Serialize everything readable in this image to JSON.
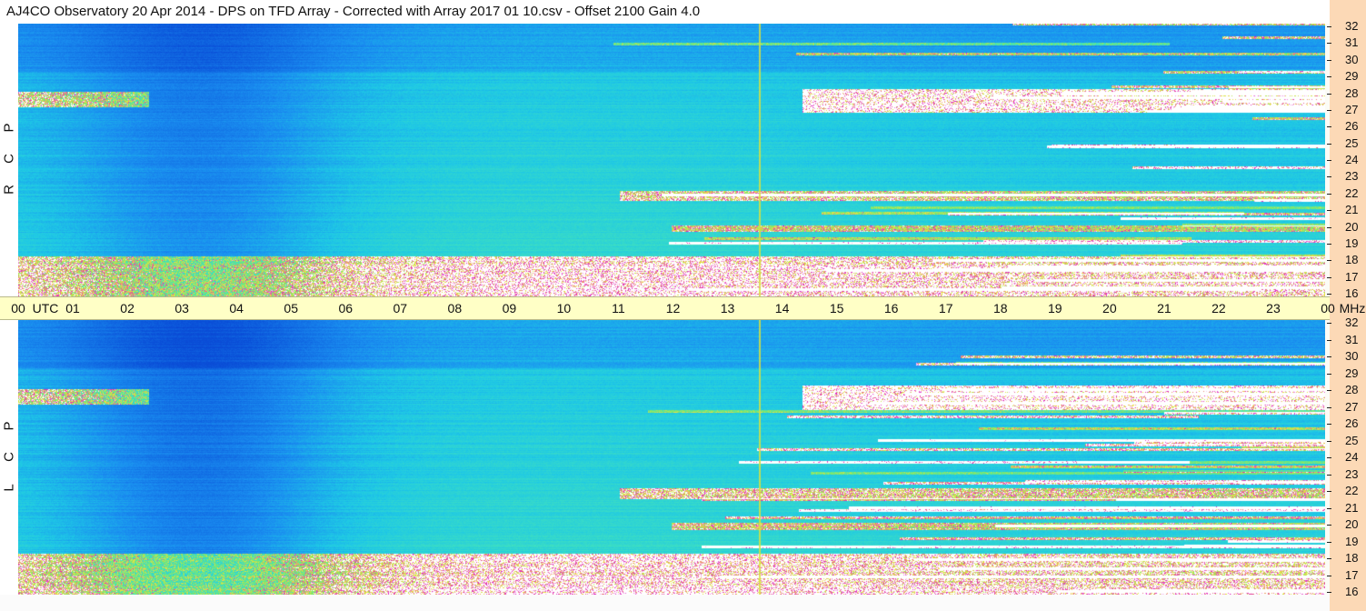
{
  "title": "AJ4CO Observatory  20 Apr 2014  -  DPS on TFD Array  -  Corrected with Array 2017 01 10.csv  -  Offset 2100  Gain 4.0",
  "chart_data": [
    {
      "type": "heatmap",
      "panel": "top",
      "polarization_label": [
        "R",
        "C",
        "P"
      ],
      "x_range_utc_hours": [
        0,
        24
      ],
      "y_range_mhz": [
        16,
        32
      ],
      "y_ticks": [
        "32",
        "31",
        "30",
        "29",
        "28",
        "27",
        "26",
        "25",
        "24",
        "23",
        "22",
        "21",
        "20",
        "19",
        "18",
        "17",
        "16"
      ]
    },
    {
      "type": "heatmap",
      "panel": "bottom",
      "polarization_label": [
        "L",
        "C",
        "P"
      ],
      "x_range_utc_hours": [
        0,
        24
      ],
      "y_range_mhz": [
        16,
        32
      ],
      "y_ticks": [
        "32",
        "31",
        "30",
        "29",
        "28",
        "27",
        "26",
        "25",
        "24",
        "23",
        "22",
        "21",
        "20",
        "19",
        "18",
        "17",
        "16"
      ]
    }
  ],
  "time_axis": {
    "labels": [
      "00",
      "UTC",
      "01",
      "02",
      "03",
      "04",
      "05",
      "06",
      "07",
      "08",
      "09",
      "10",
      "11",
      "12",
      "13",
      "14",
      "15",
      "16",
      "17",
      "18",
      "19",
      "20",
      "21",
      "22",
      "23",
      "00",
      "MHz"
    ]
  },
  "colors": {
    "low": "#0a4fd8",
    "mid": "#1ec8e6",
    "high": "#7ee86a",
    "hot": "#f0e040",
    "peak": "#e020c0",
    "sat": "#ffffff",
    "marker": "#d8e040"
  }
}
